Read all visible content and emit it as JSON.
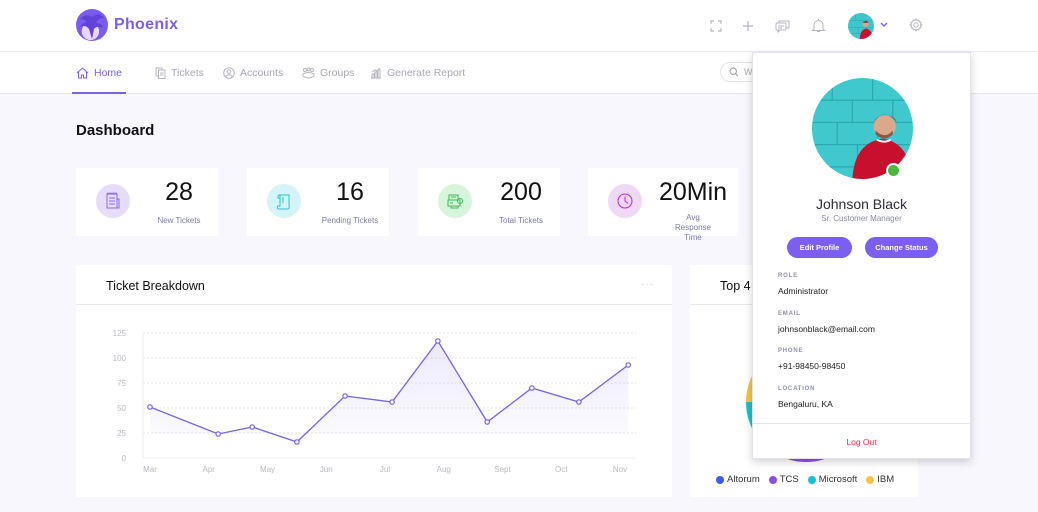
{
  "app": {
    "name": "Phoenix",
    "brand_color": "#7b5ff0"
  },
  "header": {
    "icons": [
      "fullscreen-icon",
      "plus-icon",
      "chat-icon",
      "bell-icon",
      "avatar",
      "chevron-down-icon",
      "gear-icon"
    ]
  },
  "nav": {
    "items": [
      {
        "label": "Home",
        "icon": "home-icon",
        "active": true
      },
      {
        "label": "Tickets",
        "icon": "tickets-icon",
        "active": false
      },
      {
        "label": "Accounts",
        "icon": "user-circle-icon",
        "active": false
      },
      {
        "label": "Groups",
        "icon": "groups-icon",
        "active": false
      },
      {
        "label": "Generate Report",
        "icon": "report-icon",
        "active": false
      }
    ],
    "search_placeholder": "W"
  },
  "page": {
    "title": "Dashboard"
  },
  "stats": [
    {
      "value": "28",
      "label": "New Tickets",
      "icon": "notepad-icon",
      "bg": "#e6dcfb",
      "fg": "#8d6be8"
    },
    {
      "value": "16",
      "label": "Pending Tickets",
      "icon": "scroll-icon",
      "bg": "#d5f4f7",
      "fg": "#27c3d5"
    },
    {
      "value": "200",
      "label": "Total Tickets",
      "icon": "ticket-machine-icon",
      "bg": "#d6f5dc",
      "fg": "#3dbb55"
    },
    {
      "value": "20Min",
      "label": "Avg Response Time",
      "icon": "clock-icon",
      "bg": "#f0d8f7",
      "fg": "#c235e0"
    }
  ],
  "ticket_breakdown": {
    "title": "Ticket Breakdown",
    "menu": "···"
  },
  "top4": {
    "title": "Top 4"
  },
  "chart_data": [
    {
      "type": "area",
      "title": "Ticket Breakdown",
      "xlabel": "",
      "ylabel": "",
      "categories": [
        "Mar",
        "Apr",
        "May",
        "Jun",
        "Jul",
        "Aug",
        "Sept",
        "Oct",
        "Nov"
      ],
      "x": [
        0,
        1.16,
        1.74,
        2.5,
        3.32,
        4.12,
        4.9,
        5.74,
        6.5,
        7.3,
        8.14
      ],
      "values": [
        51,
        24,
        31,
        16,
        62,
        56,
        117,
        36,
        70,
        56,
        93
      ],
      "yticks": [
        0,
        25,
        50,
        75,
        100,
        125
      ],
      "ylim": [
        0,
        125
      ],
      "grid": true,
      "line_color": "#7b5ff0"
    },
    {
      "type": "pie",
      "title": "Top 4",
      "categories": [
        "Altorum",
        "TCS",
        "Microsoft",
        "IBM"
      ],
      "values": [
        35,
        30,
        10,
        25
      ],
      "colors": [
        "#3d5af1",
        "#8a4ff0",
        "#14c3d0",
        "#f6c344"
      ],
      "legend": "bottom"
    }
  ],
  "profile": {
    "name": "Johnson Black",
    "title": "Sr. Customer Manager",
    "status": "online",
    "buttons": {
      "edit": "Edit Profile",
      "status": "Change Status"
    },
    "fields": [
      {
        "label": "ROLE",
        "value": "Administrator"
      },
      {
        "label": "EMAIL",
        "value": "johnsonblack@email.com"
      },
      {
        "label": "PHONE",
        "value": "+91-98450-98450"
      },
      {
        "label": "LOCATION",
        "value": "Bengaluru, KA"
      }
    ],
    "logout": "Log Out"
  }
}
